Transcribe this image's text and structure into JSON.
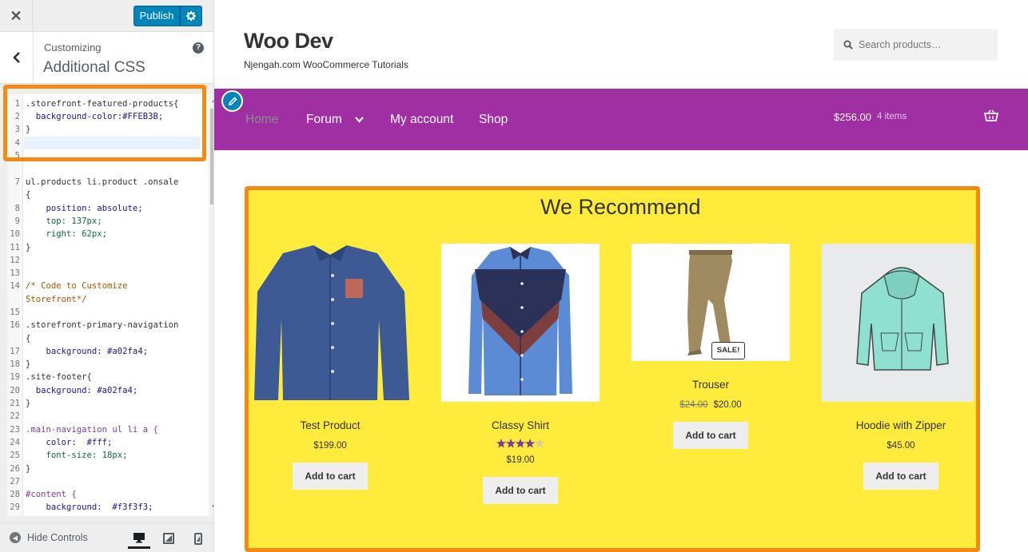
{
  "customizer": {
    "close_icon": "close-icon",
    "publish_label": "Publish",
    "section_label": "Customizing",
    "section_title": "Additional CSS",
    "help_glyph": "?",
    "hide_controls_label": "Hide Controls",
    "code_lines": [
      {
        "n": "1",
        "text": ".storefront-featured-products{"
      },
      {
        "n": "2",
        "text": "  background-color:#FFEB3B;"
      },
      {
        "n": "3",
        "text": "}"
      },
      {
        "n": "4",
        "text": ""
      },
      {
        "n": "5",
        "text": ""
      },
      {
        "n": "7",
        "text": "ul.products li.product .onsale"
      },
      {
        "n": "",
        "text": "{"
      },
      {
        "n": "8",
        "text": "    position: absolute;"
      },
      {
        "n": "9",
        "text": "    top: 137px;"
      },
      {
        "n": "10",
        "text": "    right: 62px;"
      },
      {
        "n": "11",
        "text": "}"
      },
      {
        "n": "12",
        "text": ""
      },
      {
        "n": "13",
        "text": ""
      },
      {
        "n": "14",
        "text": "/* Code to Customize"
      },
      {
        "n": "",
        "text": "Storefront*/"
      },
      {
        "n": "15",
        "text": ""
      },
      {
        "n": "16",
        "text": ".storefront-primary-navigation"
      },
      {
        "n": "",
        "text": "{"
      },
      {
        "n": "17",
        "text": "    background: #a02fa4;"
      },
      {
        "n": "18",
        "text": "}"
      },
      {
        "n": "19",
        "text": ".site-footer{"
      },
      {
        "n": "20",
        "text": "  background: #a02fa4;"
      },
      {
        "n": "21",
        "text": "}"
      },
      {
        "n": "22",
        "text": ""
      },
      {
        "n": "23",
        "text": ".main-navigation ul li a {"
      },
      {
        "n": "24",
        "text": "    color:  #fff;"
      },
      {
        "n": "25",
        "text": "    font-size: 18px;"
      },
      {
        "n": "26",
        "text": "}"
      },
      {
        "n": "27",
        "text": ""
      },
      {
        "n": "28",
        "text": "#content {"
      },
      {
        "n": "29",
        "text": "    background:  #f3f3f3;"
      }
    ]
  },
  "site": {
    "title": "Woo Dev",
    "tagline": "Njengah.com WooCommerce Tutorials",
    "search_placeholder": "Search products…",
    "nav": [
      "Home",
      "Forum",
      "My account",
      "Shop"
    ],
    "cart_total": "$256.00",
    "cart_count": "4 items",
    "nav_color": "#a02fa4"
  },
  "featured": {
    "title": "We Recommend",
    "background": "#FFEB3B",
    "products": [
      {
        "name": "Test Product",
        "price": "$199.00",
        "old_price": "",
        "rating": 0,
        "button": "Add to cart",
        "image": "blue-shirt"
      },
      {
        "name": "Classy Shirt",
        "price": "$19.00",
        "old_price": "",
        "rating": 4,
        "button": "Add to cart",
        "image": "classy-shirt"
      },
      {
        "name": "Trouser",
        "price": "$20.00",
        "old_price": "$24.00",
        "rating": 0,
        "button": "Add to cart",
        "image": "trouser",
        "badge": "SALE!"
      },
      {
        "name": "Hoodie with Zipper",
        "price": "$45.00",
        "old_price": "",
        "rating": 0,
        "button": "Add to cart",
        "image": "hoodie"
      }
    ]
  }
}
